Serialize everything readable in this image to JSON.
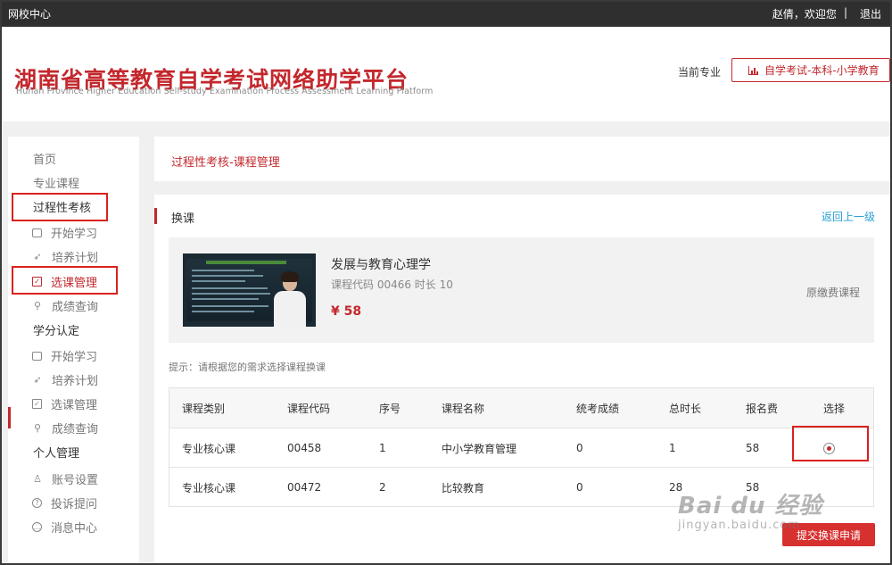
{
  "topbar": {
    "portal": "网校中心",
    "greeting": "赵倩，欢迎您",
    "separator": "|",
    "logout": "退出"
  },
  "header": {
    "logo_cn": "湖南省高等教育自学考试网络助学平台",
    "logo_en": "Hunan Province Higher Education Self-study Examination Process Assessment Learning Platform",
    "current_major_label": "当前专业",
    "current_major_value": "自学考试-本科-小学教育",
    "current_major_icon": "bar-chart-icon"
  },
  "sidebar": {
    "home": "首页",
    "courses": "专业课程",
    "process": {
      "title": "过程性考核",
      "items": [
        {
          "label": "开始学习",
          "icon": "monitor-icon"
        },
        {
          "label": "培养计划",
          "icon": "rocket-icon"
        },
        {
          "label": "选课管理",
          "icon": "checkbox-icon"
        },
        {
          "label": "成绩查询",
          "icon": "search-icon"
        }
      ]
    },
    "credit": {
      "title": "学分认定",
      "items": [
        {
          "label": "开始学习",
          "icon": "monitor-icon"
        },
        {
          "label": "培养计划",
          "icon": "rocket-icon"
        },
        {
          "label": "选课管理",
          "icon": "checkbox-icon"
        },
        {
          "label": "成绩查询",
          "icon": "search-icon"
        }
      ]
    },
    "personal": {
      "title": "个人管理",
      "items": [
        {
          "label": "账号设置",
          "icon": "user-icon"
        },
        {
          "label": "投诉提问",
          "icon": "question-icon"
        },
        {
          "label": "消息中心",
          "icon": "chat-icon"
        }
      ]
    }
  },
  "breadcrumb": "过程性考核-课程管理",
  "main": {
    "section_title": "换课",
    "back_link": "返回上一级",
    "course": {
      "name": "发展与教育心理学",
      "meta": "课程代码 00466 时长 10",
      "price": "¥ 58",
      "note": "原缴费课程"
    },
    "hint": "提示：请根据您的需求选择课程换课",
    "table": {
      "headers": [
        "课程类别",
        "课程代码",
        "序号",
        "课程名称",
        "统考成绩",
        "总时长",
        "报名费",
        "选择"
      ],
      "rows": [
        {
          "category": "专业核心课",
          "code": "00458",
          "index": "1",
          "name": "中小学教育管理",
          "score": "0",
          "hours": "1",
          "fee": "58",
          "selected": true
        },
        {
          "category": "专业核心课",
          "code": "00472",
          "index": "2",
          "name": "比较教育",
          "score": "0",
          "hours": "28",
          "fee": "58",
          "selected": false
        }
      ]
    },
    "submit": "提交换课申请"
  },
  "watermark": {
    "line1": "Bai du 经验",
    "line2": "jingyan.baidu.com"
  },
  "colors": {
    "accent": "#c3282d",
    "link": "#2a9fd6",
    "topbar": "#2f2f2f",
    "highlight": "#d8221f"
  }
}
